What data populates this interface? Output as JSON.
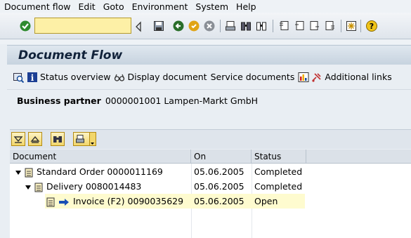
{
  "menu": [
    "Document flow",
    "Edit",
    "Goto",
    "Environment",
    "System",
    "Help"
  ],
  "toolbar": {
    "command_field_value": ""
  },
  "screen": {
    "title": "Document Flow"
  },
  "app_toolbar": {
    "status_overview": "Status overview",
    "display_document": "Display document",
    "service_documents": "Service documents",
    "additional_links": "Additional links"
  },
  "business_partner": {
    "label": "Business partner",
    "value": "0000001001 Lampen-Markt GmbH"
  },
  "grid": {
    "columns": [
      "Document",
      "On",
      "Status"
    ],
    "rows": [
      {
        "document": "Standard Order 0000011169",
        "on": "05.06.2005",
        "status": "Completed"
      },
      {
        "document": "Delivery 0080014483",
        "on": "05.06.2005",
        "status": "Completed"
      },
      {
        "document": "Invoice (F2) 0090035629",
        "on": "05.06.2005",
        "status": "Open"
      }
    ]
  },
  "colors": {
    "highlight": "#fefbcf",
    "command_field": "#fdf0a6"
  }
}
